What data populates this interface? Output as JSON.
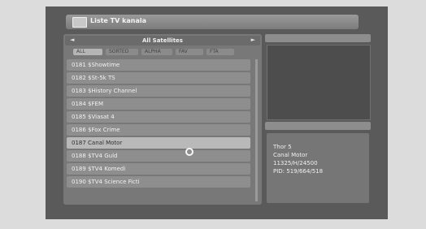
{
  "window": {
    "title": "Liste TV kanala",
    "icon": "tv-icon"
  },
  "satellite": {
    "label": "All Satellites"
  },
  "tabs": [
    {
      "label": "ALL",
      "active": true
    },
    {
      "label": "SORTED",
      "active": false
    },
    {
      "label": "ALPHA",
      "active": false
    },
    {
      "label": "FAV",
      "active": false
    },
    {
      "label": "FTA",
      "active": false
    }
  ],
  "channels": [
    {
      "label": "0181 $Showtime",
      "selected": false
    },
    {
      "label": "0182 $St-5k TS",
      "selected": false
    },
    {
      "label": "0183 $History Channel",
      "selected": false
    },
    {
      "label": "0184 $FEM",
      "selected": false
    },
    {
      "label": "0185 $Viasat 4",
      "selected": false
    },
    {
      "label": "0186 $Fox Crime",
      "selected": false
    },
    {
      "label": "0187 Canal Motor",
      "selected": true
    },
    {
      "label": "0188 $TV4 Guld",
      "selected": false
    },
    {
      "label": "0189 $TV4 Komedi",
      "selected": false
    },
    {
      "label": "0190 $TV4 Science Ficti",
      "selected": false
    }
  ],
  "info": {
    "satellite": "Thor 5",
    "channel": "Canal Motor",
    "frequency": "11325/H/24500",
    "pid": "PID: 519/664/518"
  },
  "colors": {
    "background": "#5a5a5a",
    "selected_row": "#b9b9b9",
    "row": "#8e8e8e"
  }
}
